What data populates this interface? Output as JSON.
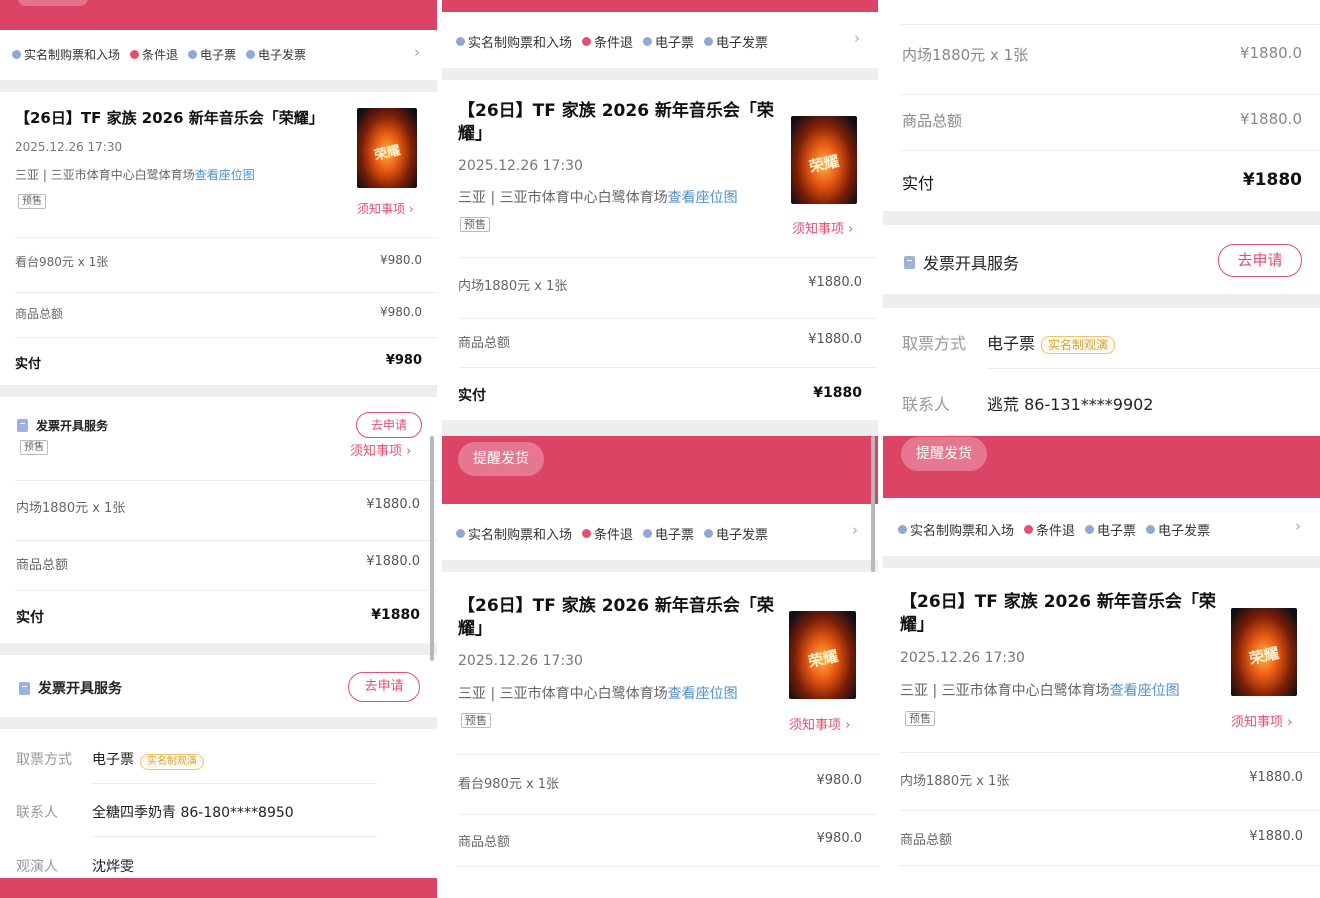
{
  "common": {
    "tags": [
      "实名制购票和入场",
      "条件退",
      "电子票",
      "电子发票"
    ],
    "event_title": "【26日】TF 家族 2026 新年音乐会「荣耀」",
    "event_title_l1": "【26日】TF 家族 2026 新年音乐会「荣",
    "event_title_l2": "耀」",
    "date": "2025.12.26 17:30",
    "venue": "三亚 | 三亚市体育中心白鹭体育场",
    "seat_map": "查看座位图",
    "presale": "预售",
    "notice": "须知事项 ›",
    "poster_glyph": "荣耀",
    "subtotal_label": "商品总额",
    "paid_label": "实付",
    "invoice_label": "发票开具服务",
    "apply_label": "去申请",
    "remind_label": "提醒发货",
    "pickup_label": "取票方式",
    "pickup_value": "电子票",
    "realname_tag": "实名制观演",
    "contact_label": "联系人",
    "viewer_label": "观演人"
  },
  "col1": {
    "item1": "看台980元 x 1张",
    "item1_price": "¥980.0",
    "subtotal1": "¥980.0",
    "paid1": "¥980",
    "item2": "内场1880元 x 1张",
    "item2_price": "¥1880.0",
    "subtotal2": "¥1880.0",
    "paid2": "¥1880",
    "contact_value": "全糖四季奶青 86-180****8950",
    "viewer_value": "沈烨雯"
  },
  "col2": {
    "item1": "内场1880元 x 1张",
    "item1_price": "¥1880.0",
    "subtotal1": "¥1880.0",
    "paid1": "¥1880",
    "item2": "看台980元 x 1张",
    "item2_price": "¥980.0",
    "subtotal2": "¥980.0"
  },
  "col3": {
    "item1": "内场1880元 x 1张",
    "item1_price": "¥1880.0",
    "subtotal1": "¥1880.0",
    "paid1": "¥1880",
    "contact_value": "逃荒 86-131****9902",
    "item2": "内场1880元 x 1张",
    "item2_price": "¥1880.0",
    "subtotal2": "¥1880.0"
  }
}
